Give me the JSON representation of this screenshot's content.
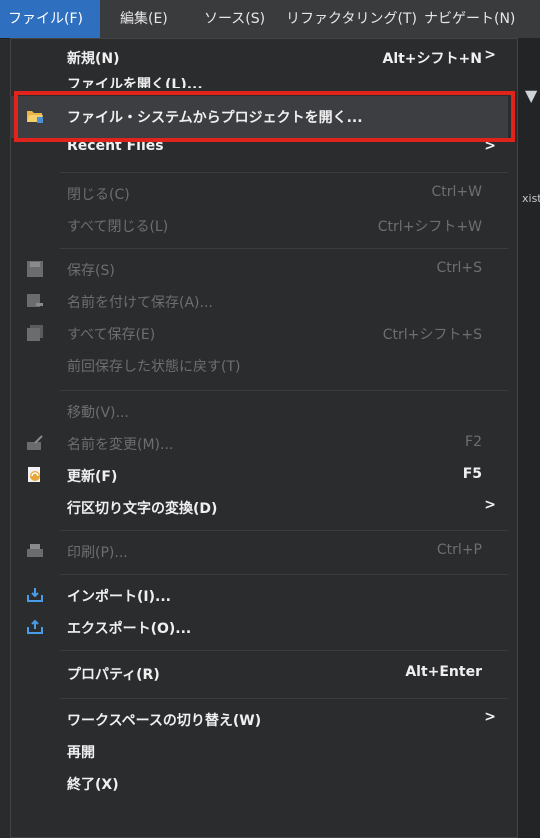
{
  "menubar": {
    "items": [
      {
        "label": "ファイル(F)",
        "active": true
      },
      {
        "label": "編集(E)"
      },
      {
        "label": "ソース(S)"
      },
      {
        "label": "リファクタリング(T)"
      },
      {
        "label": "ナビゲート(N)"
      }
    ]
  },
  "editor_fragments": {
    "filter_icon": "filter-icon",
    "text": "xist"
  },
  "file_menu": {
    "new": {
      "label": "新規(N)",
      "shortcut": "Alt+シフト+N",
      "arrow": ">"
    },
    "open_file": {
      "label": "ファイルを開く(L)..."
    },
    "open_project": {
      "label": "ファイル・システムからプロジェクトを開く...",
      "icon": "folder-open-icon"
    },
    "recent": {
      "label": "Recent Files",
      "arrow": ">"
    },
    "close": {
      "label": "閉じる(C)",
      "shortcut": "Ctrl+W"
    },
    "close_all": {
      "label": "すべて閉じる(L)",
      "shortcut": "Ctrl+シフト+W"
    },
    "save": {
      "label": "保存(S)",
      "shortcut": "Ctrl+S",
      "icon": "save-icon"
    },
    "save_as": {
      "label": "名前を付けて保存(A)...",
      "icon": "save-as-icon"
    },
    "save_all": {
      "label": "すべて保存(E)",
      "shortcut": "Ctrl+シフト+S",
      "icon": "save-all-icon"
    },
    "revert": {
      "label": "前回保存した状態に戻す(T)"
    },
    "move": {
      "label": "移動(V)..."
    },
    "rename": {
      "label": "名前を変更(M)...",
      "shortcut": "F2",
      "icon": "rename-icon"
    },
    "refresh": {
      "label": "更新(F)",
      "shortcut": "F5",
      "icon": "refresh-icon"
    },
    "line_delimiters": {
      "label": "行区切り文字の変換(D)",
      "arrow": ">"
    },
    "print": {
      "label": "印刷(P)...",
      "shortcut": "Ctrl+P",
      "icon": "print-icon"
    },
    "import": {
      "label": "インポート(I)...",
      "icon": "import-icon"
    },
    "export": {
      "label": "エクスポート(O)...",
      "icon": "export-icon"
    },
    "properties": {
      "label": "プロパティ(R)",
      "shortcut": "Alt+Enter"
    },
    "switch_workspace": {
      "label": "ワークスペースの切り替え(W)",
      "arrow": ">"
    },
    "restart": {
      "label": "再開"
    },
    "exit": {
      "label": "終了(X)"
    }
  },
  "colors": {
    "highlight_border": "#e0231b",
    "active_menu": "#2f6fc0"
  }
}
